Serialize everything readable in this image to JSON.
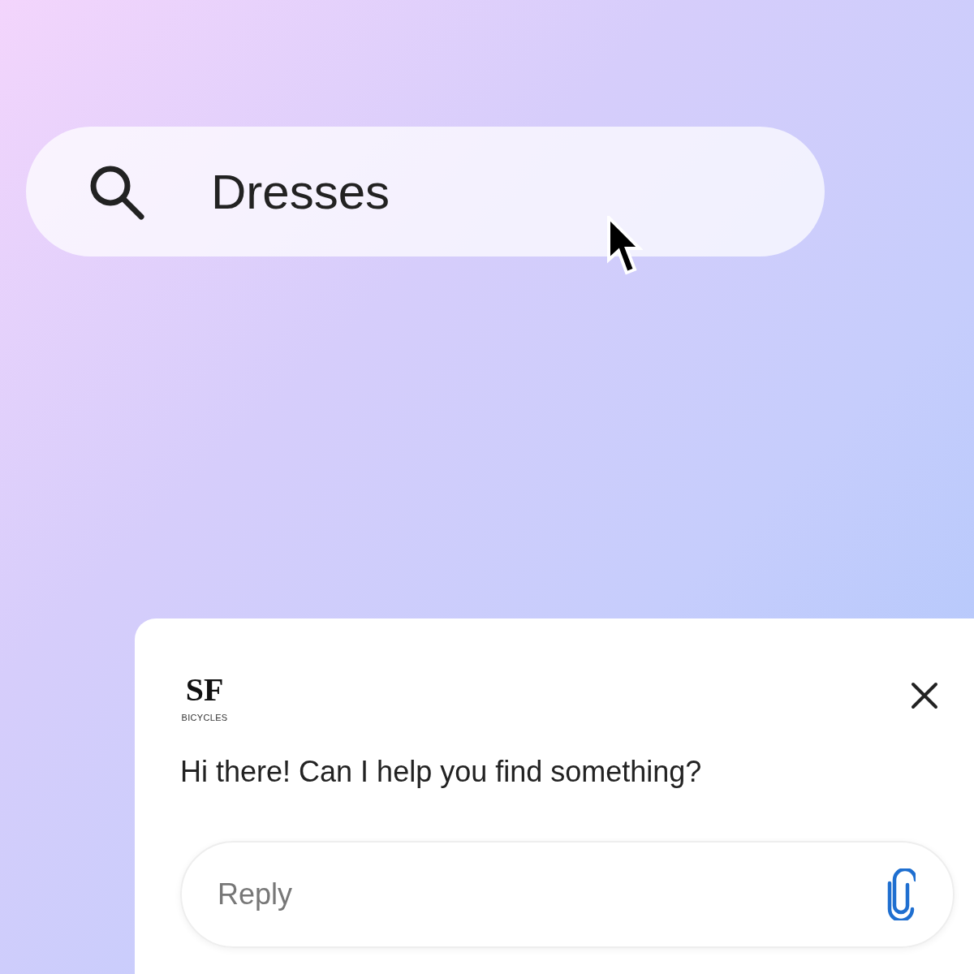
{
  "search": {
    "value": "Dresses"
  },
  "chat": {
    "logo": {
      "initials": "SF",
      "subtitle": "BICYCLES"
    },
    "message": "Hi there! Can I help you find something?",
    "reply": {
      "placeholder": "Reply"
    }
  }
}
